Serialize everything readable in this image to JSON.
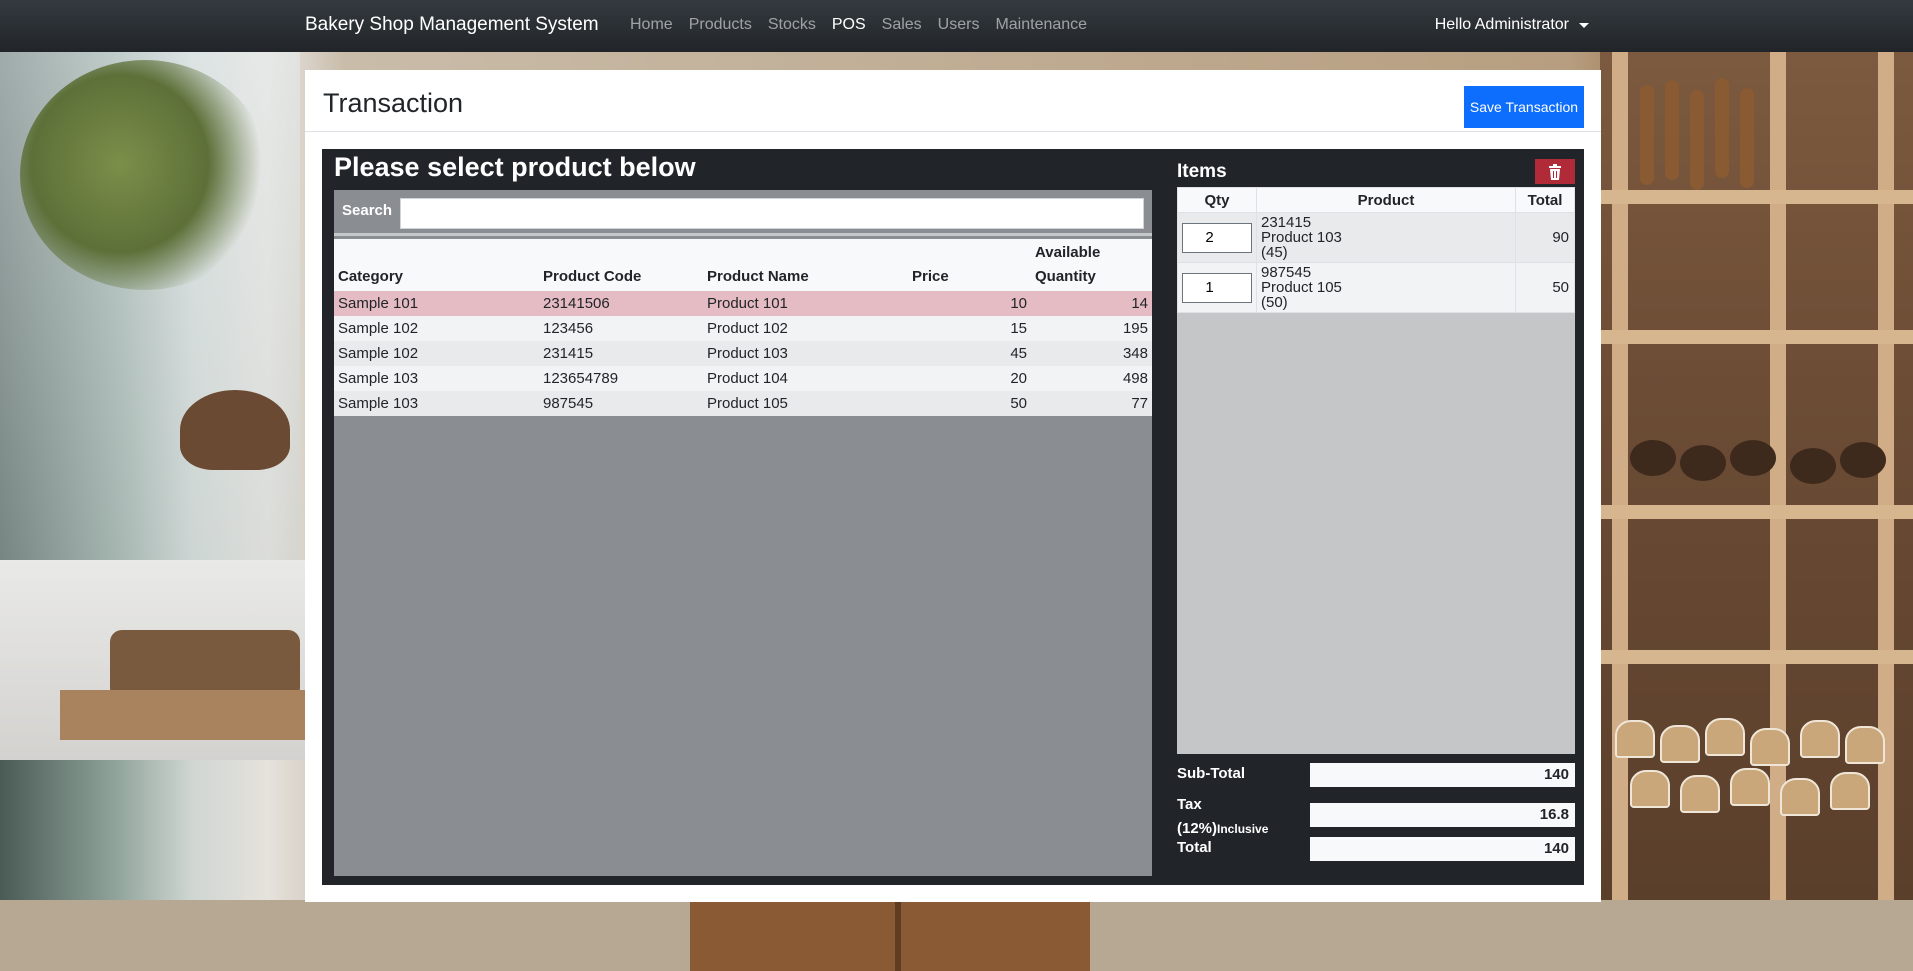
{
  "navbar": {
    "brand": "Bakery Shop Management System",
    "links": [
      "Home",
      "Products",
      "Stocks",
      "POS",
      "Sales",
      "Users",
      "Maintenance"
    ],
    "active": "POS",
    "user": "Hello Administrator"
  },
  "page": {
    "title": "Transaction",
    "save_label": "Save Transaction",
    "select_title": "Please select product below"
  },
  "search": {
    "label": "Search",
    "value": "",
    "placeholder": ""
  },
  "products": {
    "headers": [
      "Category",
      "Product Code",
      "Product Name",
      "Price",
      "Available",
      "Quantity"
    ],
    "rows": [
      {
        "category": "Sample 101",
        "code": "23141506",
        "name": "Product 101",
        "price": "10",
        "qty": "14"
      },
      {
        "category": "Sample 102",
        "code": "123456",
        "name": "Product 102",
        "price": "15",
        "qty": "195"
      },
      {
        "category": "Sample 102",
        "code": "231415",
        "name": "Product 103",
        "price": "45",
        "qty": "348"
      },
      {
        "category": "Sample 103",
        "code": "123654789",
        "name": "Product 104",
        "price": "20",
        "qty": "498"
      },
      {
        "category": "Sample 103",
        "code": "987545",
        "name": "Product 105",
        "price": "50",
        "qty": "77"
      }
    ]
  },
  "items": {
    "title": "Items",
    "headers": [
      "Qty",
      "Product",
      "Total"
    ],
    "rows": [
      {
        "qty": "2",
        "code": "231415",
        "name": "Product 103",
        "price": "(45)",
        "total": "90"
      },
      {
        "qty": "1",
        "code": "987545",
        "name": "Product 105",
        "price": "(50)",
        "total": "50"
      }
    ]
  },
  "summary": {
    "subtotal_label": "Sub-Total",
    "subtotal": "140",
    "tax_label": "Tax",
    "tax_rate": "(12%)",
    "tax_note": "Inclusive",
    "tax": "16.8",
    "total_label": "Total",
    "total": "140"
  },
  "colors": {
    "navbar": "#212529",
    "primary": "#0d6efd",
    "danger": "#b02a37",
    "selected_row": "#e5bcc3"
  },
  "icons": {
    "delete": "trash-icon",
    "user_menu": "caret-down-icon"
  }
}
